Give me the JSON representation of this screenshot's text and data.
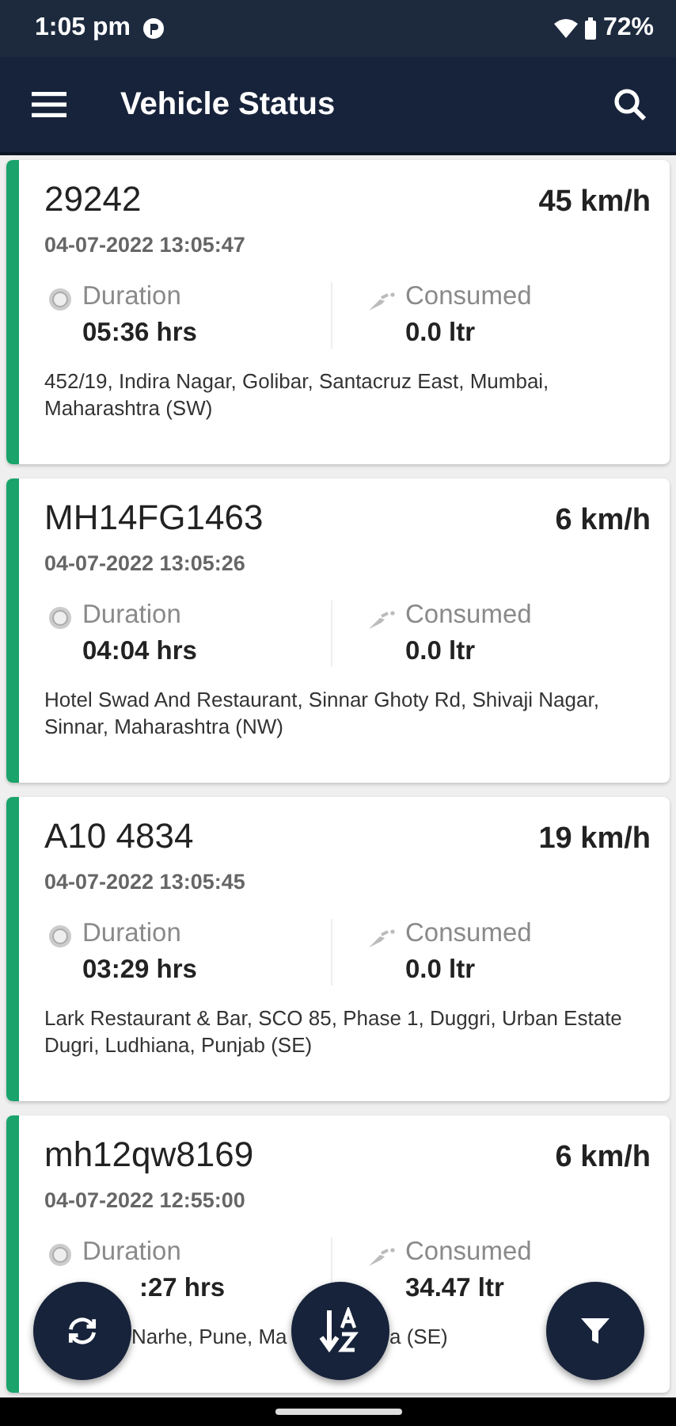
{
  "status_bar": {
    "time": "1:05 pm",
    "battery": "72%"
  },
  "app_bar": {
    "title": "Vehicle Status"
  },
  "vehicles": [
    {
      "kind": "full",
      "plate": "29242",
      "speed": "45 km/h",
      "timestamp": "04-07-2022 13:05:47",
      "duration_label": "Duration",
      "duration": "05:36 hrs",
      "consumed_label": "Consumed",
      "consumed": "0.0 ltr",
      "address": [
        "452/19, Indira Nagar, Golibar, Santacruz East, Mumbai, Maharashtra (SW)"
      ]
    },
    {
      "kind": "full",
      "plate": "MH14FG1463",
      "speed": "6 km/h",
      "timestamp": "04-07-2022 13:05:26",
      "duration_label": "Duration",
      "duration": "04:04 hrs",
      "consumed_label": "Consumed",
      "consumed": "0.0 ltr",
      "address": [
        "Hotel Swad And Restaurant, Sinnar Ghoty Rd, Shivaji Nagar, Sinnar, Maharashtra (NW)"
      ]
    },
    {
      "kind": "full",
      "plate": "A10 4834",
      "speed": "19 km/h",
      "timestamp": "04-07-2022 13:05:45",
      "duration_label": "Duration",
      "duration": "03:29 hrs",
      "consumed_label": "Consumed",
      "consumed": "0.0 ltr",
      "address": [
        "Lark Restaurant & Bar, SCO 85, Phase 1, Duggri, Urban Estate Dugri, Ludhiana, Punjab (SE)"
      ]
    },
    {
      "kind": "covered",
      "plate": "mh12qw8169",
      "speed": "6 km/h",
      "timestamp": "04-07-2022 12:55:00",
      "duration_label": "Duration",
      "duration": ":27 hrs",
      "consumed_label": "Consumed",
      "consumed": "34.47 ltr",
      "address": [
        "Narhe, Pune, Ma",
        "a (SE)"
      ]
    }
  ]
}
